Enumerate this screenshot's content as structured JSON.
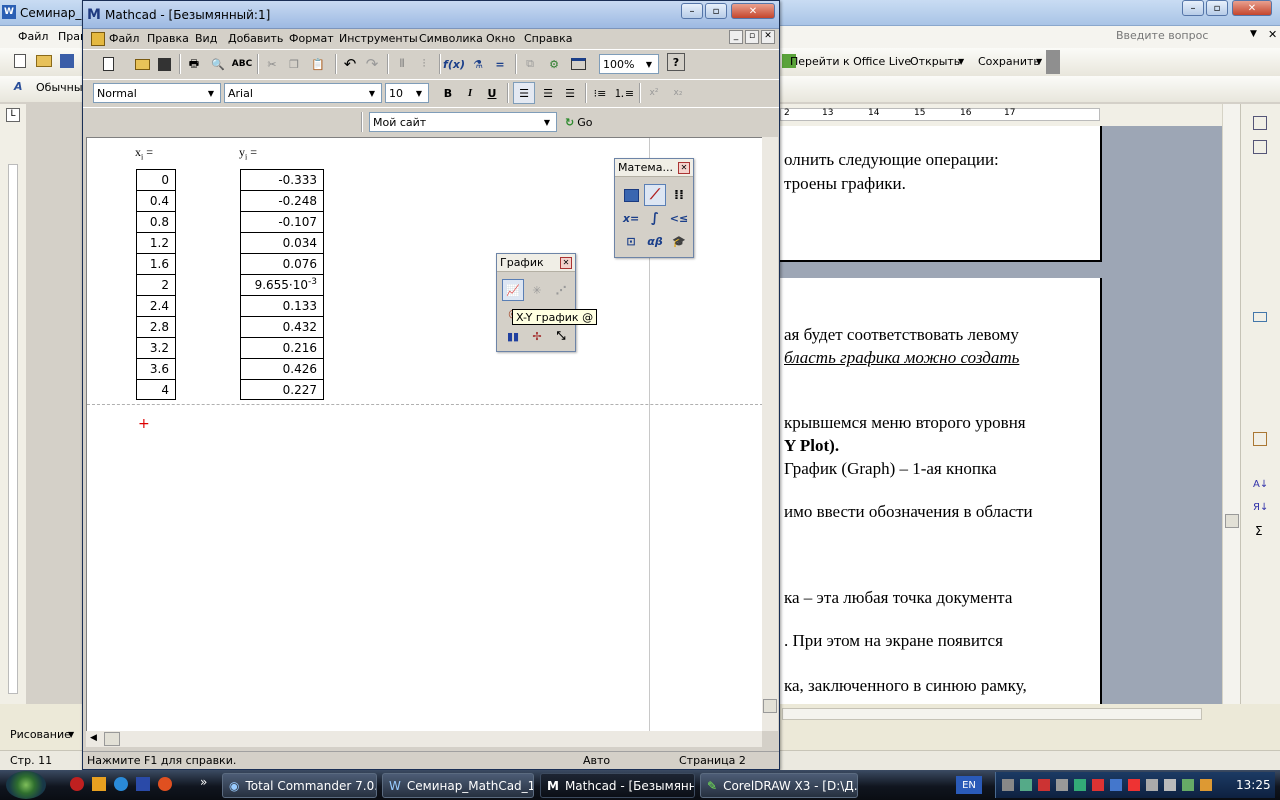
{
  "word": {
    "title": "Семинар_Ма",
    "menu": [
      "Файл",
      "Прав"
    ],
    "style_label": "Обычный",
    "office_live": "Перейти к Office Live",
    "open_label": "Открыть",
    "save_label": "Сохранить",
    "help_placeholder": "Введите вопрос",
    "ruler_marks": [
      "2",
      "13",
      "14",
      "15",
      "16",
      "17"
    ],
    "drawing_label": "Рисование",
    "status_page": "Стр. 11",
    "doc_lines": [
      "олнить следующие операции:",
      "троены графики.",
      "ая будет соответствовать левому",
      "бласть графика можно создать",
      "крывшемся меню второго уровня",
      "Y Plot).",
      "График (Graph) – 1-ая кнопка",
      "имо ввести обозначения в области",
      "ка – эта любая точка документа",
      ". При этом на экране появится",
      "ка, заключенного в синюю рамку,"
    ]
  },
  "mathcad": {
    "title": "Mathcad - [Безымянный:1]",
    "menu": [
      "Файл",
      "Правка",
      "Вид",
      "Добавить",
      "Формат",
      "Инструменты",
      "Символика",
      "Окно",
      "Справка"
    ],
    "zoom": "100%",
    "style": "Normal",
    "font": "Arial",
    "size": "10",
    "site": "Мой сайт",
    "go": "Go",
    "x_label": "x",
    "y_label": "y",
    "subscript": "i",
    "equals": "=",
    "x_values": [
      "0",
      "0.4",
      "0.8",
      "1.2",
      "1.6",
      "2",
      "2.4",
      "2.8",
      "3.2",
      "3.6",
      "4"
    ],
    "y_values": [
      "-0.333",
      "-0.248",
      "-0.107",
      "0.034",
      "0.076",
      "9.655·10",
      "0.133",
      "0.432",
      "0.216",
      "0.426",
      "0.227"
    ],
    "y_exponent": "-3",
    "status_help": "Нажмите F1 для справки.",
    "status_mode": "Авто",
    "status_page": "Страница 2"
  },
  "palette_math": {
    "title": "Матема..."
  },
  "palette_graph": {
    "title": "График",
    "tooltip": "X-Y график @"
  },
  "taskbar": {
    "tasks": [
      "Total Commander 7.0...",
      "Семинар_MathCad_1(...",
      "Mathcad - [Безымянн...",
      "CorelDRAW X3 - [D:\\Д..."
    ],
    "lang": "EN",
    "clock": "13:25"
  }
}
